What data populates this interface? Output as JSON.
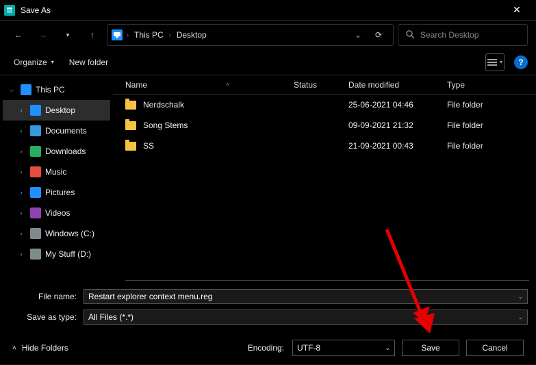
{
  "window": {
    "title": "Save As"
  },
  "nav": {
    "breadcrumb": [
      "This PC",
      "Desktop"
    ],
    "search_placeholder": "Search Desktop"
  },
  "toolbar": {
    "organize": "Organize",
    "new_folder": "New folder"
  },
  "sidebar": {
    "items": [
      {
        "label": "This PC",
        "icon": "pc",
        "expanded": true,
        "indent": 0
      },
      {
        "label": "Desktop",
        "icon": "desktop",
        "indent": 1,
        "selected": true,
        "expandable": true
      },
      {
        "label": "Documents",
        "icon": "doc",
        "indent": 1,
        "expandable": true
      },
      {
        "label": "Downloads",
        "icon": "down",
        "indent": 1,
        "expandable": true
      },
      {
        "label": "Music",
        "icon": "music",
        "indent": 1,
        "expandable": true
      },
      {
        "label": "Pictures",
        "icon": "pic",
        "indent": 1,
        "expandable": true
      },
      {
        "label": "Videos",
        "icon": "vid",
        "indent": 1,
        "expandable": true
      },
      {
        "label": "Windows (C:)",
        "icon": "drive",
        "indent": 1,
        "expandable": true
      },
      {
        "label": "My Stuff (D:)",
        "icon": "drive",
        "indent": 1,
        "expandable": true
      }
    ]
  },
  "columns": {
    "name": "Name",
    "status": "Status",
    "date": "Date modified",
    "type": "Type"
  },
  "files": [
    {
      "name": "Nerdschalk",
      "date": "25-06-2021 04:46",
      "type": "File folder"
    },
    {
      "name": "Song Stems",
      "date": "09-09-2021 21:32",
      "type": "File folder"
    },
    {
      "name": "SS",
      "date": "21-09-2021 00:43",
      "type": "File folder"
    }
  ],
  "form": {
    "filename_label": "File name:",
    "filename_value": "Restart explorer context menu.reg",
    "saveastype_label": "Save as type:",
    "saveastype_value": "All Files  (*.*)"
  },
  "footer": {
    "hide_folders": "Hide Folders",
    "encoding_label": "Encoding:",
    "encoding_value": "UTF-8",
    "save": "Save",
    "cancel": "Cancel"
  }
}
